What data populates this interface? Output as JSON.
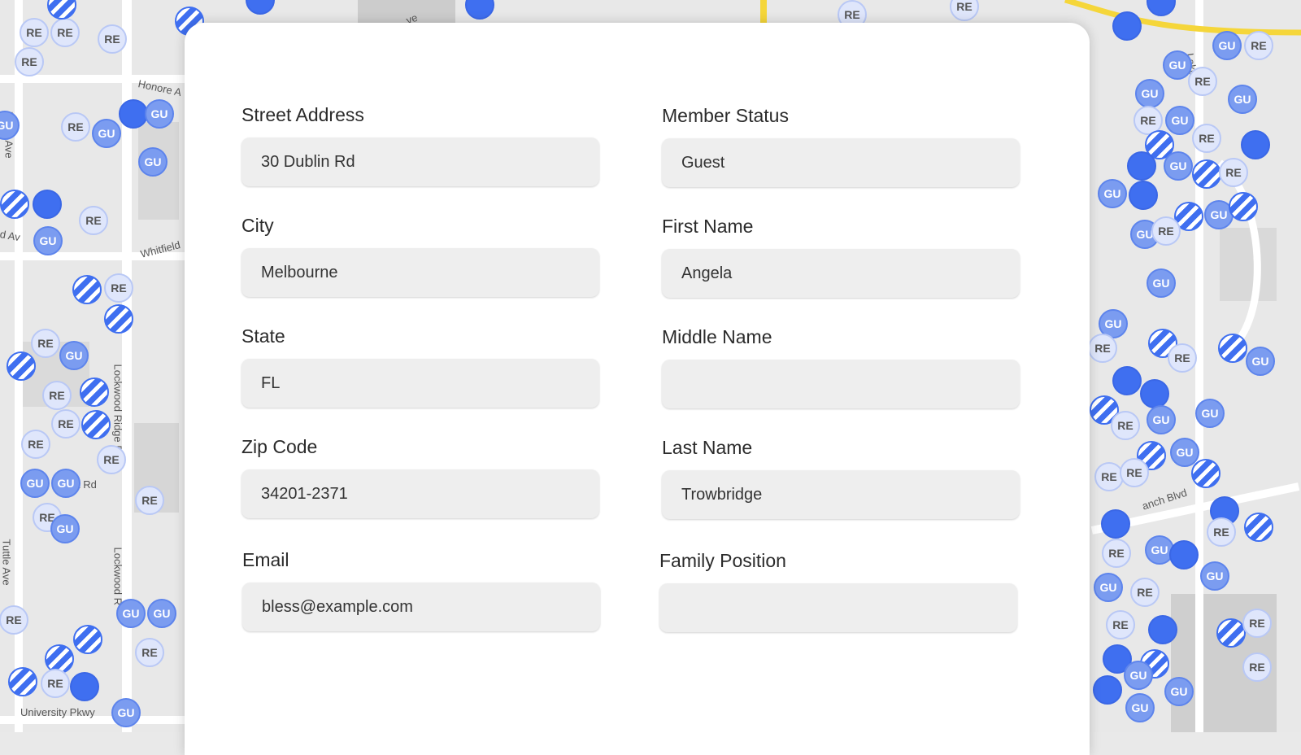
{
  "map": {
    "street_labels": [
      "Honore A",
      "Whitfield",
      "Lockwood Ridge R",
      "Lockwood R",
      "Tuttle Ave",
      "Tuttle Ave",
      "University Pkwy",
      "t Rd",
      "d Av",
      "ve",
      "Lake",
      "anch Blvd"
    ],
    "marker_labels": {
      "re": "RE",
      "gu": "GU"
    },
    "colors": {
      "marker_solid": "#3f6ff0",
      "marker_light": "#dfe6fb",
      "road_highlight": "#f5d63a"
    }
  },
  "form": {
    "left": [
      {
        "label": "Street Address",
        "value": "30 Dublin Rd"
      },
      {
        "label": "City",
        "value": "Melbourne"
      },
      {
        "label": "State",
        "value": "FL"
      },
      {
        "label": "Zip Code",
        "value": "34201-2371"
      },
      {
        "label": "Email",
        "value": "bless@example.com"
      }
    ],
    "right": [
      {
        "label": "Member Status",
        "value": "Guest"
      },
      {
        "label": "First Name",
        "value": "Angela"
      },
      {
        "label": "Middle Name",
        "value": ""
      },
      {
        "label": "Last Name",
        "value": "Trowbridge"
      },
      {
        "label": "Family Position",
        "value": ""
      }
    ]
  }
}
